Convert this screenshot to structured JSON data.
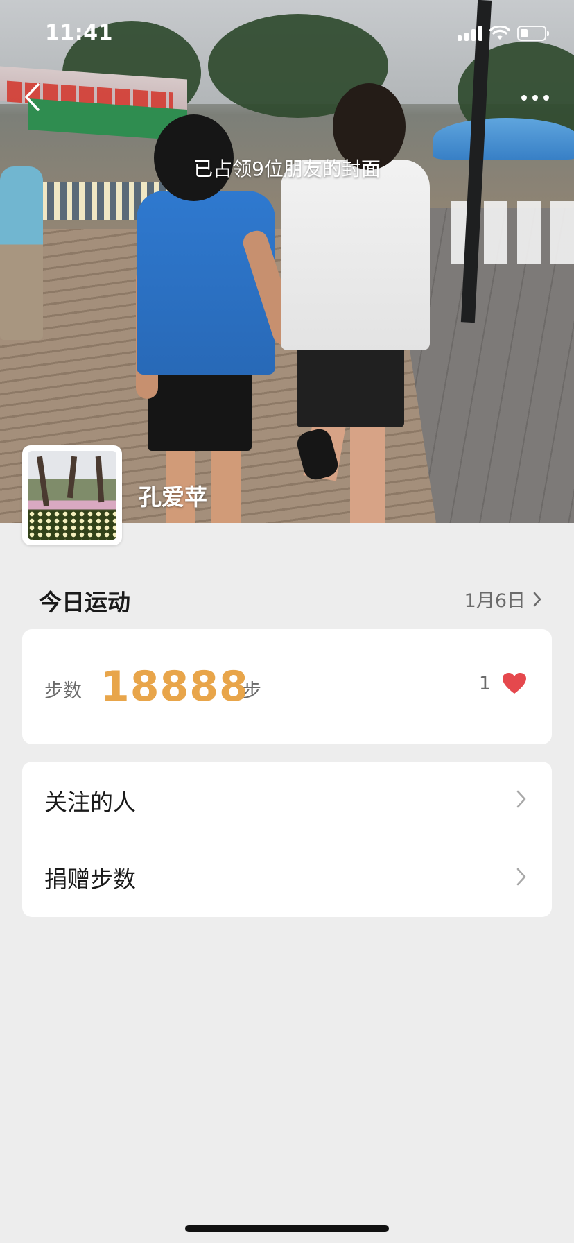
{
  "status_bar": {
    "time": "11:41",
    "signal_icon": "signal-icon",
    "wifi_icon": "wifi-icon",
    "battery_icon": "battery-icon"
  },
  "header": {
    "back_icon": "chevron-left-icon",
    "more_icon": "ellipsis-icon"
  },
  "cover": {
    "caption": "已占领9位朋友的封面"
  },
  "profile": {
    "name": "孔爱苹"
  },
  "today": {
    "title": "今日运动",
    "date": "1月6日"
  },
  "steps": {
    "label": "步数",
    "value": "18888",
    "unit": "步",
    "likes": "1",
    "heart_icon": "heart-icon"
  },
  "menu": {
    "items": [
      {
        "label": "关注的人"
      },
      {
        "label": "捐赠步数"
      }
    ]
  },
  "colors": {
    "accent": "#e8a54a",
    "heart": "#e5484d",
    "background": "#ededed"
  }
}
